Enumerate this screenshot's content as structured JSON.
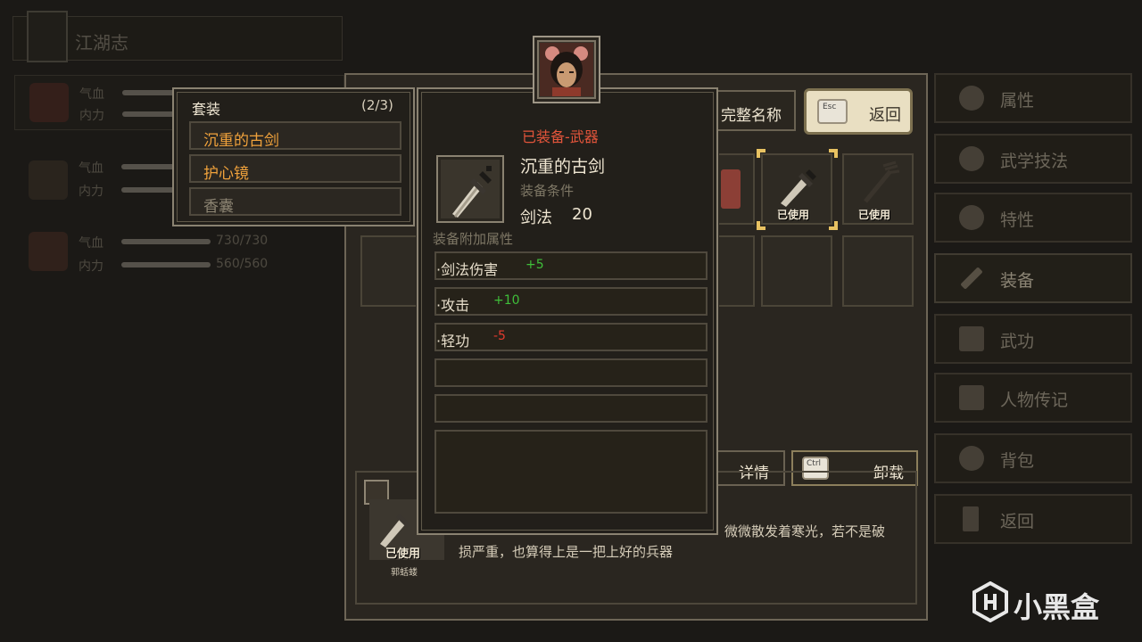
{
  "background": {
    "title": "江湖志",
    "characters": [
      {
        "hp_label": "气血",
        "mp_label": "内力",
        "hp_value": "",
        "mp_value": ""
      },
      {
        "hp_label": "气血",
        "mp_label": "内力",
        "hp_value": "",
        "mp_value": ""
      },
      {
        "hp_label": "气血",
        "mp_label": "内力",
        "hp_value": "730/730",
        "mp_value": "560/560"
      }
    ],
    "full_name_button": "完整名称",
    "return_button": "返回",
    "esc_key": "Esc",
    "ctrl_key": "Ctrl",
    "details_button": "详情",
    "unequip_button": "卸载",
    "equipment_slots": [
      {
        "used": false,
        "label": ""
      },
      {
        "used": true,
        "label": "已使用"
      },
      {
        "used": true,
        "label": "已使用"
      }
    ],
    "equipped_item_label": "已使用",
    "equipped_item_owner": "郭蛞蝼",
    "description": "微微散发着寒光，若不是破损严重，也算得上是一把上好的兵器",
    "description_line1": "微微散发着寒光，若不是破",
    "description_line2": "损严重，也算得上是一把上好的兵器"
  },
  "right_menu": {
    "items": [
      {
        "label": "属性",
        "icon": "person-icon"
      },
      {
        "label": "武学技法",
        "icon": "martial-art-icon"
      },
      {
        "label": "特性",
        "icon": "trait-icon"
      },
      {
        "label": "装备",
        "icon": "sword-icon"
      },
      {
        "label": "武功",
        "icon": "book-icon"
      },
      {
        "label": "人物传记",
        "icon": "scroll-icon"
      },
      {
        "label": "背包",
        "icon": "bag-icon"
      },
      {
        "label": "返回",
        "icon": "door-icon"
      }
    ]
  },
  "set_panel": {
    "title": "套装",
    "count": "(2/3)",
    "items": [
      {
        "name": "沉重的古剑",
        "active": true
      },
      {
        "name": "护心镜",
        "active": true
      },
      {
        "name": "香囊",
        "active": false
      }
    ]
  },
  "card": {
    "header": "已装备-武器",
    "item_name": "沉重的古剑",
    "requirement_label": "装备条件",
    "requirement_skill": "剑法",
    "requirement_value": "20",
    "attr_section_label": "装备附加属性",
    "attributes": [
      {
        "name": "·剑法伤害",
        "value": "+5",
        "type": "positive"
      },
      {
        "name": "·攻击",
        "value": "+10",
        "type": "positive"
      },
      {
        "name": "·轻功",
        "value": "-5",
        "type": "negative"
      },
      {
        "name": "",
        "value": "",
        "type": "empty"
      },
      {
        "name": "",
        "value": "",
        "type": "empty"
      }
    ]
  },
  "watermark": {
    "text": "小黑盒"
  },
  "colors": {
    "accent_orange": "#f0a23c",
    "header_red": "#e4553b",
    "positive_green": "#3fbf3a",
    "negative_red": "#e23b2e",
    "muted_text": "#8d8573",
    "gold_frame": "#e8c262"
  }
}
